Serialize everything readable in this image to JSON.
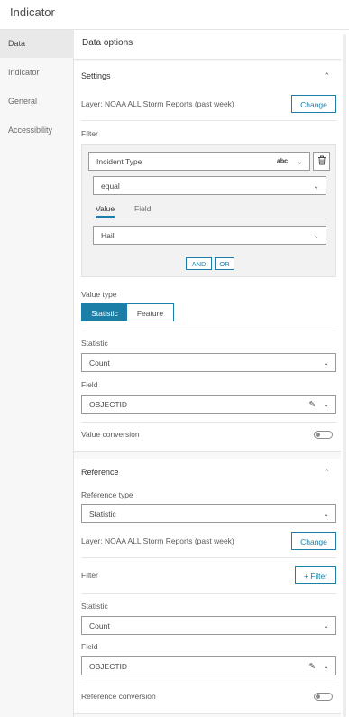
{
  "window": {
    "title": "Indicator"
  },
  "sidebar": {
    "items": [
      {
        "label": "Data",
        "active": true
      },
      {
        "label": "Indicator",
        "active": false
      },
      {
        "label": "General",
        "active": false
      },
      {
        "label": "Accessibility",
        "active": false
      }
    ]
  },
  "panel": {
    "title": "Data options"
  },
  "settings": {
    "title": "Settings",
    "layer_label": "Layer: NOAA ALL Storm Reports (past week)",
    "change_label": "Change",
    "filter_label": "Filter",
    "filter": {
      "field_value": "Incident Type",
      "field_type_badge": "abc",
      "operator_value": "equal",
      "tabs": [
        "Value",
        "Field"
      ],
      "active_tab": "Value",
      "value": "Hail",
      "and_label": "AND",
      "or_label": "OR"
    },
    "value_type_label": "Value type",
    "value_type_options": [
      "Statistic",
      "Feature"
    ],
    "value_type_selected": "Statistic",
    "statistic_label": "Statistic",
    "statistic_value": "Count",
    "field_label": "Field",
    "field_value": "OBJECTID",
    "value_conversion_label": "Value conversion",
    "value_conversion_on": false
  },
  "reference": {
    "title": "Reference",
    "reference_type_label": "Reference type",
    "reference_type_value": "Statistic",
    "layer_label": "Layer: NOAA ALL Storm Reports (past week)",
    "change_label": "Change",
    "filter_label": "Filter",
    "add_filter_label": "+ Filter",
    "statistic_label": "Statistic",
    "statistic_value": "Count",
    "field_label": "Field",
    "field_value": "OBJECTID",
    "reference_conversion_label": "Reference conversion",
    "reference_conversion_on": false
  },
  "colors": {
    "accent": "#1a7ea6",
    "sidebar_bg": "#f7f7f7",
    "active_item_bg": "#e9e9e9"
  }
}
